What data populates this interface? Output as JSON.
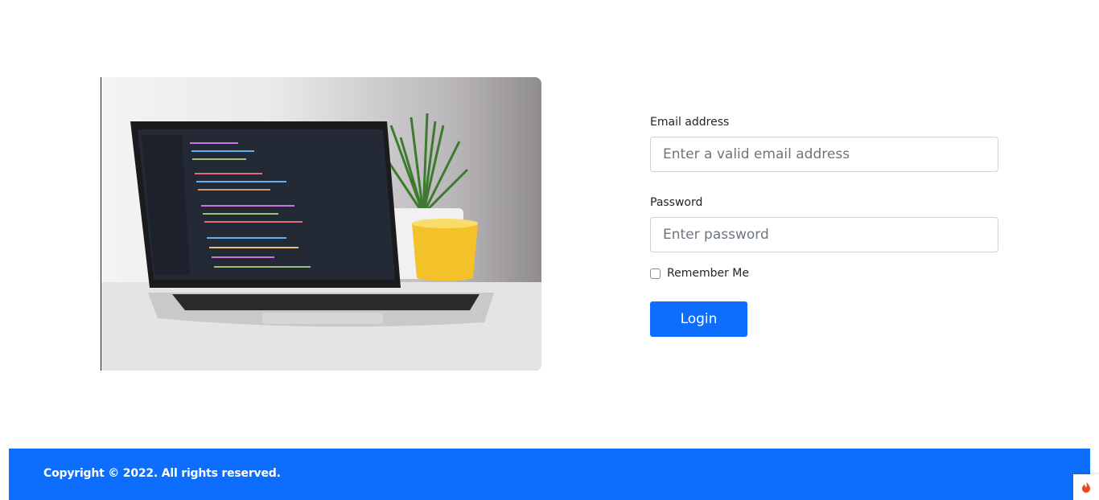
{
  "login_form": {
    "email_label": "Email address",
    "email_placeholder": "Enter a valid email address",
    "password_label": "Password",
    "password_placeholder": "Enter password",
    "remember_label": "Remember Me",
    "login_button": "Login"
  },
  "footer": {
    "copyright": "Copyright © 2022. All rights reserved."
  },
  "colors": {
    "primary": "#0d6efd",
    "corner_icon": "#e8491d"
  },
  "icons": {
    "corner_widget": "flame-icon"
  }
}
